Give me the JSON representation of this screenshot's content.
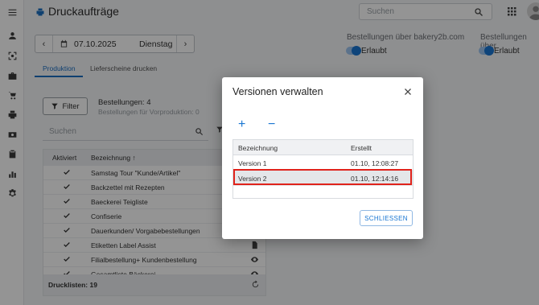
{
  "app": {
    "title": "Druckaufträge"
  },
  "search": {
    "placeholder": "Suchen"
  },
  "datepicker": {
    "date": "07.10.2025",
    "weekday": "Dienstag",
    "prev_symbol": "‹",
    "next_symbol": "›"
  },
  "options": [
    {
      "label": "Bestellungen über bakery2b.com",
      "state": "Erlaubt"
    },
    {
      "label": "Bestellungen über",
      "state": "Erlaubt"
    }
  ],
  "tabs": [
    {
      "label": "Produktion",
      "active": true
    },
    {
      "label": "Lieferscheine drucken",
      "active": false
    }
  ],
  "filter": {
    "button_label": "Filter",
    "orders": "Bestellungen: 4",
    "preorders": "Bestellungen für Vorproduktion: 0"
  },
  "list": {
    "search_placeholder": "Suchen",
    "columns": {
      "active": "Aktiviert",
      "name": "Bezeichnung ↑"
    },
    "rows": [
      {
        "name": "Samstag Tour \"Kunde/Artikel\"",
        "icon": ""
      },
      {
        "name": "Backzettel mit Rezepten",
        "icon": ""
      },
      {
        "name": "Baeckerei Teigliste",
        "icon": ""
      },
      {
        "name": "Confiserie",
        "icon": ""
      },
      {
        "name": "Dauerkunden/ Vorgabebestellungen",
        "icon": ""
      },
      {
        "name": "Etiketten Label Assist",
        "icon": "document-icon"
      },
      {
        "name": "Filialbestellung+ Kundenbestellung",
        "icon": "eye-icon"
      },
      {
        "name": "Gesamtliste Bäckerei",
        "icon": "eye-icon"
      }
    ],
    "footer": "Drucklisten: 19"
  },
  "dialog": {
    "title": "Versionen verwalten",
    "add_symbol": "+",
    "remove_symbol": "−",
    "columns": {
      "name": "Bezeichnung",
      "created": "Erstellt"
    },
    "versions": [
      {
        "name": "Version 1",
        "created": "01.10, 12:08:27",
        "selected": false
      },
      {
        "name": "Version 2",
        "created": "01.10, 12:14:16",
        "selected": true
      }
    ],
    "close_button": "SCHLIESSEN"
  },
  "colors": {
    "accent": "#1976d2",
    "highlight": "#e0231b",
    "overlay": "rgba(0,0,0,0.42)"
  },
  "icons": [
    "menu-icon",
    "user-icon",
    "scan-icon",
    "briefcase-icon",
    "cart-icon",
    "printer-icon",
    "money-icon",
    "clipboard-icon",
    "chart-icon",
    "settings-icon"
  ]
}
